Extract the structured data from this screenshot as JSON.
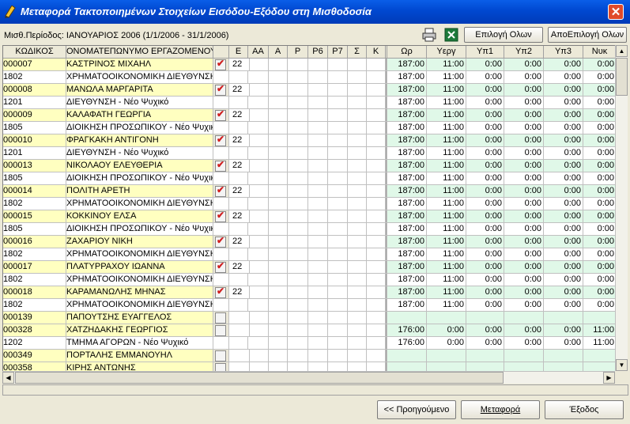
{
  "window": {
    "title": "Μεταφορά Τακτοποιημένων Στοιχείων Εισόδου-Εξόδου στη Μισθοδοσία",
    "close": "✕"
  },
  "toolbar": {
    "period": "Μισθ.Περίοδος: ΙΑΝΟΥΑΡΙΟΣ 2006 (1/1/2006 - 31/1/2006)",
    "select_all": "Επιλογή Ολων",
    "deselect_all": "ΑποΕπιλογή Ολων"
  },
  "columns": [
    "ΚΩΔΙΚΟΣ",
    "ΟΝΟΜΑΤΕΠΩΝΥΜΟ ΕΡΓΑΖΟΜΕΝΟΥ",
    "",
    "Ε",
    "ΑΑ",
    "Α",
    "Ρ",
    "Ρ6",
    "Ρ7",
    "Σ",
    "Κ",
    "",
    "Ωρ",
    "Υεργ",
    "Υπ1",
    "Υπ2",
    "Υπ3",
    "Νυκ"
  ],
  "rows": [
    {
      "type": "emp",
      "code": "000007",
      "name": "ΚΑΣΤΡΙΝΟΣ ΜΙΧΑΗΛ",
      "checked": true,
      "e": "22",
      "vals": [
        "187:00",
        "11:00",
        "0:00",
        "0:00",
        "0:00",
        "0:00"
      ]
    },
    {
      "type": "dept",
      "code": "1802",
      "name": "ΧΡΗΜΑΤΟΟΙΚΟΝΟΜΙΚΗ ΔΙΕΥΘΥΝΣΗ - Ν",
      "vals": [
        "187:00",
        "11:00",
        "0:00",
        "0:00",
        "0:00",
        "0:00"
      ]
    },
    {
      "type": "emp",
      "code": "000008",
      "name": "ΜΑΝΩΛΑ ΜΑΡΓΑΡΙΤΑ",
      "checked": true,
      "e": "22",
      "vals": [
        "187:00",
        "11:00",
        "0:00",
        "0:00",
        "0:00",
        "0:00"
      ]
    },
    {
      "type": "dept",
      "code": "1201",
      "name": "ΔΙΕΥΘΥΝΣΗ - Νέο Ψυχικό",
      "vals": [
        "187:00",
        "11:00",
        "0:00",
        "0:00",
        "0:00",
        "0:00"
      ]
    },
    {
      "type": "emp",
      "code": "000009",
      "name": "ΚΑΛΑΦΑΤΗ ΓΕΩΡΓΙΑ",
      "checked": true,
      "e": "22",
      "vals": [
        "187:00",
        "11:00",
        "0:00",
        "0:00",
        "0:00",
        "0:00"
      ]
    },
    {
      "type": "dept",
      "code": "1805",
      "name": "ΔΙΟΙΚΗΣΗ ΠΡΟΣΩΠΙΚΟΥ - Νέο Ψυχικό",
      "vals": [
        "187:00",
        "11:00",
        "0:00",
        "0:00",
        "0:00",
        "0:00"
      ]
    },
    {
      "type": "emp",
      "code": "000010",
      "name": "ΦΡΑΓΚΑΚΗ ΑΝΤΙΓΟΝΗ",
      "checked": true,
      "e": "22",
      "vals": [
        "187:00",
        "11:00",
        "0:00",
        "0:00",
        "0:00",
        "0:00"
      ]
    },
    {
      "type": "dept",
      "code": "1201",
      "name": "ΔΙΕΥΘΥΝΣΗ - Νέο Ψυχικό",
      "vals": [
        "187:00",
        "11:00",
        "0:00",
        "0:00",
        "0:00",
        "0:00"
      ]
    },
    {
      "type": "emp",
      "code": "000013",
      "name": "ΝΙΚΟΛΑΟΥ ΕΛΕΥΘΕΡΙΑ",
      "checked": true,
      "e": "22",
      "vals": [
        "187:00",
        "11:00",
        "0:00",
        "0:00",
        "0:00",
        "0:00"
      ]
    },
    {
      "type": "dept",
      "code": "1805",
      "name": "ΔΙΟΙΚΗΣΗ ΠΡΟΣΩΠΙΚΟΥ - Νέο Ψυχικό",
      "vals": [
        "187:00",
        "11:00",
        "0:00",
        "0:00",
        "0:00",
        "0:00"
      ]
    },
    {
      "type": "emp",
      "code": "000014",
      "name": "ΠΟΛΙΤΗ ΑΡΕΤΗ",
      "checked": true,
      "e": "22",
      "vals": [
        "187:00",
        "11:00",
        "0:00",
        "0:00",
        "0:00",
        "0:00"
      ]
    },
    {
      "type": "dept",
      "code": "1802",
      "name": "ΧΡΗΜΑΤΟΟΙΚΟΝΟΜΙΚΗ ΔΙΕΥΘΥΝΣΗ - Ν",
      "vals": [
        "187:00",
        "11:00",
        "0:00",
        "0:00",
        "0:00",
        "0:00"
      ]
    },
    {
      "type": "emp",
      "code": "000015",
      "name": "ΚΟΚΚΙΝΟΥ ΕΛΣΑ",
      "checked": true,
      "e": "22",
      "vals": [
        "187:00",
        "11:00",
        "0:00",
        "0:00",
        "0:00",
        "0:00"
      ]
    },
    {
      "type": "dept",
      "code": "1805",
      "name": "ΔΙΟΙΚΗΣΗ ΠΡΟΣΩΠΙΚΟΥ - Νέο Ψυχικό",
      "vals": [
        "187:00",
        "11:00",
        "0:00",
        "0:00",
        "0:00",
        "0:00"
      ]
    },
    {
      "type": "emp",
      "code": "000016",
      "name": "ΖΑΧΑΡΙΟΥ ΝΙΚΗ",
      "checked": true,
      "e": "22",
      "vals": [
        "187:00",
        "11:00",
        "0:00",
        "0:00",
        "0:00",
        "0:00"
      ]
    },
    {
      "type": "dept",
      "code": "1802",
      "name": "ΧΡΗΜΑΤΟΟΙΚΟΝΟΜΙΚΗ ΔΙΕΥΘΥΝΣΗ - Ν",
      "vals": [
        "187:00",
        "11:00",
        "0:00",
        "0:00",
        "0:00",
        "0:00"
      ]
    },
    {
      "type": "emp",
      "code": "000017",
      "name": "ΠΛΑΤΥΡΡΑΧΟΥ ΙΩΑΝΝΑ",
      "checked": true,
      "e": "22",
      "vals": [
        "187:00",
        "11:00",
        "0:00",
        "0:00",
        "0:00",
        "0:00"
      ]
    },
    {
      "type": "dept",
      "code": "1802",
      "name": "ΧΡΗΜΑΤΟΟΙΚΟΝΟΜΙΚΗ ΔΙΕΥΘΥΝΣΗ - Ν",
      "vals": [
        "187:00",
        "11:00",
        "0:00",
        "0:00",
        "0:00",
        "0:00"
      ]
    },
    {
      "type": "emp",
      "code": "000018",
      "name": "ΚΑΡΑΜΑΝΩΛΗΣ ΜΗΝΑΣ",
      "checked": true,
      "e": "22",
      "vals": [
        "187:00",
        "11:00",
        "0:00",
        "0:00",
        "0:00",
        "0:00"
      ]
    },
    {
      "type": "dept",
      "code": "1802",
      "name": "ΧΡΗΜΑΤΟΟΙΚΟΝΟΜΙΚΗ ΔΙΕΥΘΥΝΣΗ - Ν",
      "vals": [
        "187:00",
        "11:00",
        "0:00",
        "0:00",
        "0:00",
        "0:00"
      ]
    },
    {
      "type": "emp",
      "code": "000139",
      "name": "ΠΑΠΟΥΤΣΗΣ ΕΥΑΓΓΕΛΟΣ",
      "checked": false,
      "e": "",
      "vals": [
        "",
        "",
        "",
        "",
        "",
        ""
      ]
    },
    {
      "type": "emp",
      "code": "000328",
      "name": "ΧΑΤΖΗΔΑΚΗΣ ΓΕΩΡΓΙΟΣ",
      "checked": false,
      "e": "",
      "vals": [
        "176:00",
        "0:00",
        "0:00",
        "0:00",
        "0:00",
        "11:00"
      ]
    },
    {
      "type": "dept",
      "code": "1202",
      "name": "ΤΜΗΜΑ ΑΓΟΡΩΝ - Νέο Ψυχικό",
      "vals": [
        "176:00",
        "0:00",
        "0:00",
        "0:00",
        "0:00",
        "11:00"
      ]
    },
    {
      "type": "emp",
      "code": "000349",
      "name": "ΠΟΡΤΑΛΗΣ ΕΜΜΑΝΟΥΗΛ",
      "checked": false,
      "e": "",
      "vals": [
        "",
        "",
        "",
        "",
        "",
        ""
      ]
    },
    {
      "type": "emp",
      "code": "000358",
      "name": "ΚΙΡΗΣ ΑΝΤΩΝΗΣ",
      "checked": false,
      "e": "",
      "vals": [
        "",
        "",
        "",
        "",
        "",
        ""
      ]
    }
  ],
  "footer": {
    "prev": "<< Προηγούμενο",
    "transfer": "Μεταφορά",
    "exit": "Έξοδος"
  }
}
